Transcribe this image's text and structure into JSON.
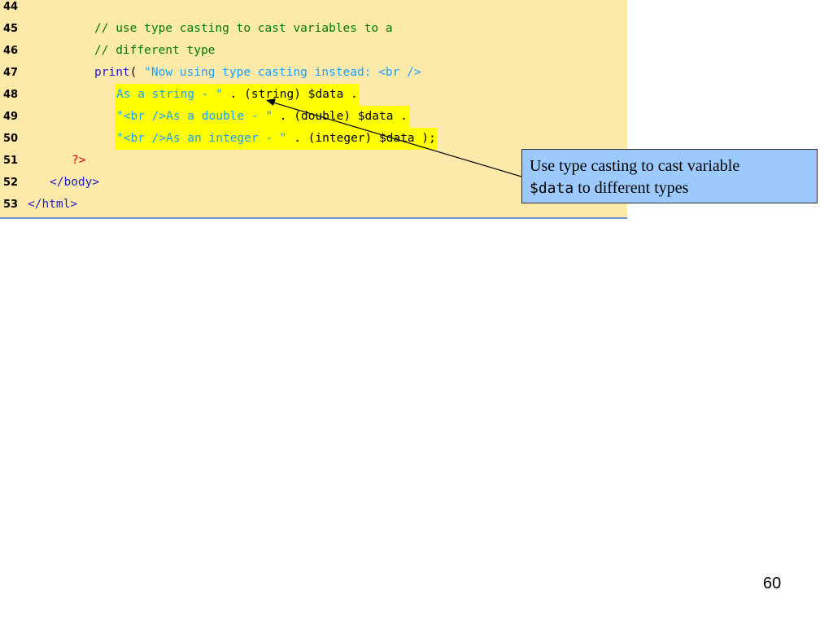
{
  "code_lines": [
    {
      "num": "44",
      "text": ""
    },
    {
      "num": "45",
      "text": "// use type casting to cast variables to a"
    },
    {
      "num": "46",
      "text": "// different type"
    },
    {
      "num": "47",
      "print": "print",
      "paren": "( ",
      "string": "\"Now using type casting instead: <br />"
    },
    {
      "num": "48",
      "string": "As a string - \"",
      "rest": " . (string) $data ."
    },
    {
      "num": "49",
      "string": "\"<br />As a double - \"",
      "rest": " . (double) $data ."
    },
    {
      "num": "50",
      "string": "\"<br />As an integer - \"",
      "rest": " . (integer) $data );"
    },
    {
      "num": "51",
      "text": "?>"
    },
    {
      "num": "52",
      "text": "</body>"
    },
    {
      "num": "53",
      "text": "</html>"
    }
  ],
  "callout": {
    "line1": "Use type casting to cast variable",
    "mono": "$data",
    "line2_rest": " to different types"
  },
  "page_number": "60",
  "colors": {
    "panel_background": "#fde9a9",
    "comment": "#007b00",
    "keyword": "#1f1fcf",
    "string": "#18a0ff",
    "highlight": "#ffff00",
    "callout_background": "#9ccaff"
  }
}
